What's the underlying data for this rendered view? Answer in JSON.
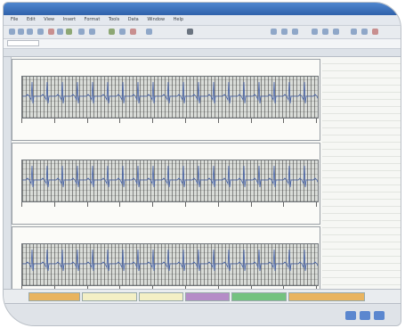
{
  "window": {
    "title": ""
  },
  "menu": {
    "items": [
      "File",
      "Edit",
      "View",
      "Insert",
      "Format",
      "Tools",
      "Data",
      "Window",
      "Help"
    ]
  },
  "formula": {
    "name_box": "",
    "fx": ""
  },
  "charts": [
    {
      "title": "",
      "subtitle": ""
    },
    {
      "title": "",
      "subtitle": ""
    },
    {
      "title": "",
      "subtitle": ""
    }
  ],
  "sheet_tabs": [
    {
      "label": "",
      "color": "#e9b45f"
    },
    {
      "label": "",
      "color": "#f3efc5"
    },
    {
      "label": "",
      "color": "#f3efc5"
    },
    {
      "label": "",
      "color": "#b58cc7"
    },
    {
      "label": "",
      "color": "#74c27f"
    },
    {
      "label": "",
      "color": "#e9b45f"
    }
  ],
  "status": {
    "text": ""
  },
  "colors": {
    "trace": "#4763a8",
    "titlebar": "#2f61aa"
  },
  "icons": [
    "new-icon",
    "open-icon",
    "save-icon",
    "print-icon",
    "cut-icon",
    "copy-icon",
    "paste-icon",
    "undo-icon",
    "chart-icon",
    "zoom-icon"
  ]
}
